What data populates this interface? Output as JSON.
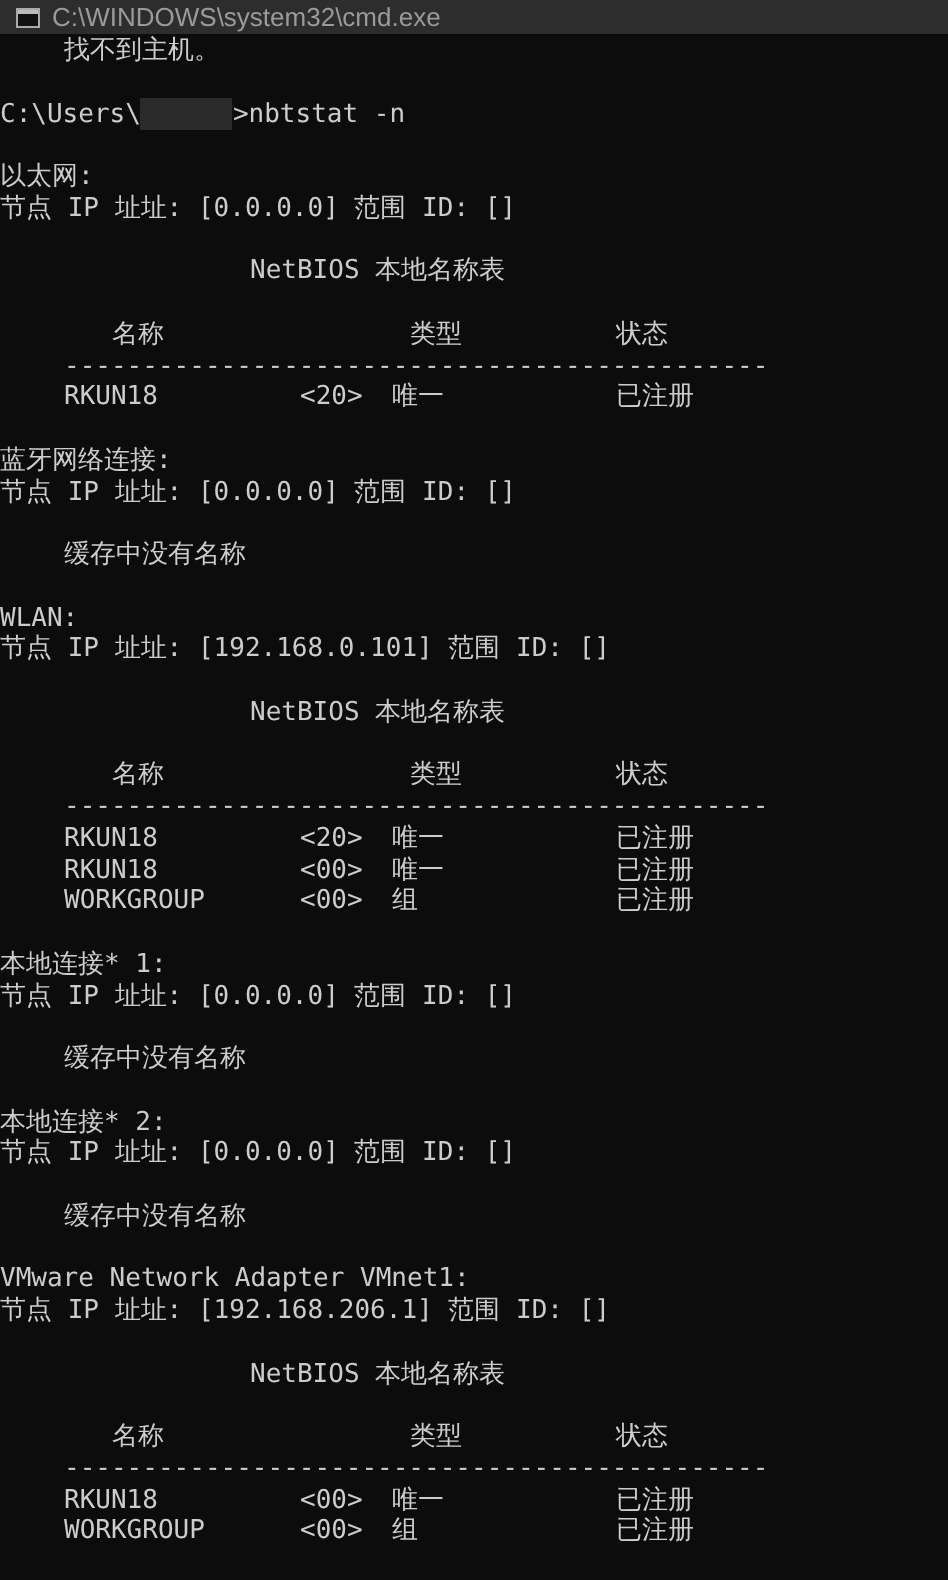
{
  "window": {
    "title": "C:\\WINDOWS\\system32\\cmd.exe"
  },
  "lines": [
    {
      "kind": "text",
      "indented": true,
      "text": "找不到主机。"
    },
    {
      "kind": "blank"
    },
    {
      "kind": "prompt",
      "path": "C:\\Users\\",
      "command": ">nbtstat -n"
    },
    {
      "kind": "blank"
    },
    {
      "kind": "text",
      "indented": false,
      "text": "以太网:"
    },
    {
      "kind": "text",
      "indented": false,
      "text": "节点 IP 址址: [0.0.0.0] 范围 ID: []"
    },
    {
      "kind": "blank"
    },
    {
      "kind": "title",
      "text": "NetBIOS 本地名称表"
    },
    {
      "kind": "blank"
    },
    {
      "kind": "header",
      "name": "名称",
      "type": "类型",
      "status": "状态"
    },
    {
      "kind": "rule",
      "text": "---------------------------------------------"
    },
    {
      "kind": "row",
      "name": "RKUN18",
      "code": "<20>",
      "type": "唯一",
      "status": "已注册"
    },
    {
      "kind": "blank"
    },
    {
      "kind": "text",
      "indented": false,
      "text": "蓝牙网络连接:"
    },
    {
      "kind": "text",
      "indented": false,
      "text": "节点 IP 址址: [0.0.0.0] 范围 ID: []"
    },
    {
      "kind": "blank"
    },
    {
      "kind": "text",
      "indented": true,
      "text": "缓存中没有名称"
    },
    {
      "kind": "blank"
    },
    {
      "kind": "text",
      "indented": false,
      "text": "WLAN:"
    },
    {
      "kind": "text",
      "indented": false,
      "text": "节点 IP 址址: [192.168.0.101] 范围 ID: []"
    },
    {
      "kind": "blank"
    },
    {
      "kind": "title",
      "text": "NetBIOS 本地名称表"
    },
    {
      "kind": "blank"
    },
    {
      "kind": "header",
      "name": "名称",
      "type": "类型",
      "status": "状态"
    },
    {
      "kind": "rule",
      "text": "---------------------------------------------"
    },
    {
      "kind": "row",
      "name": "RKUN18",
      "code": "<20>",
      "type": "唯一",
      "status": "已注册"
    },
    {
      "kind": "row",
      "name": "RKUN18",
      "code": "<00>",
      "type": "唯一",
      "status": "已注册"
    },
    {
      "kind": "row",
      "name": "WORKGROUP",
      "code": "<00>",
      "type": "组",
      "status": "已注册"
    },
    {
      "kind": "blank"
    },
    {
      "kind": "text",
      "indented": false,
      "text": "本地连接* 1:"
    },
    {
      "kind": "text",
      "indented": false,
      "text": "节点 IP 址址: [0.0.0.0] 范围 ID: []"
    },
    {
      "kind": "blank"
    },
    {
      "kind": "text",
      "indented": true,
      "text": "缓存中没有名称"
    },
    {
      "kind": "blank"
    },
    {
      "kind": "text",
      "indented": false,
      "text": "本地连接* 2:"
    },
    {
      "kind": "text",
      "indented": false,
      "text": "节点 IP 址址: [0.0.0.0] 范围 ID: []"
    },
    {
      "kind": "blank"
    },
    {
      "kind": "text",
      "indented": true,
      "text": "缓存中没有名称"
    },
    {
      "kind": "blank"
    },
    {
      "kind": "text",
      "indented": false,
      "text": "VMware Network Adapter VMnet1:"
    },
    {
      "kind": "text",
      "indented": false,
      "text": "节点 IP 址址: [192.168.206.1] 范围 ID: []"
    },
    {
      "kind": "blank"
    },
    {
      "kind": "title",
      "text": "NetBIOS 本地名称表"
    },
    {
      "kind": "blank"
    },
    {
      "kind": "header",
      "name": "名称",
      "type": "类型",
      "status": "状态"
    },
    {
      "kind": "rule",
      "text": "---------------------------------------------"
    },
    {
      "kind": "row",
      "name": "RKUN18",
      "code": "<00>",
      "type": "唯一",
      "status": "已注册"
    },
    {
      "kind": "row",
      "name": "WORKGROUP",
      "code": "<00>",
      "type": "组",
      "status": "已注册"
    }
  ]
}
